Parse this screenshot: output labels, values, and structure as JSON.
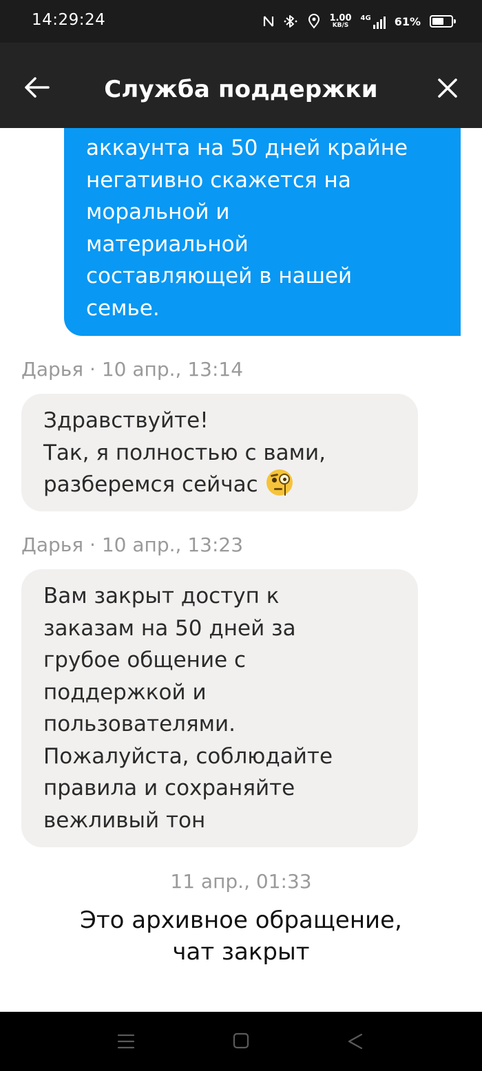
{
  "status_bar": {
    "time": "14:29:24",
    "speed_value": "1.00",
    "speed_unit": "KB/S",
    "network_type": "4G",
    "battery_percent": "61%",
    "battery_level": 0.61,
    "icons": [
      "nfc-icon",
      "bluetooth-icon",
      "location-icon",
      "signal-icon",
      "battery-icon"
    ]
  },
  "header": {
    "title": "Служба поддержки",
    "back_icon": "arrow-left-icon",
    "close_icon": "close-icon"
  },
  "messages": [
    {
      "from": "user",
      "lines": [
        "аккаунта на 50 дней крайне",
        "негативно скажется на",
        "моральной и",
        "материальной",
        "составляющей в нашей",
        "семье."
      ]
    },
    {
      "from": "support",
      "meta": "Дарья · 10 апр., 13:14",
      "lines": [
        "Здравствуйте!",
        "Так, я полностью с вами,",
        "разберемся сейчас"
      ],
      "emoji": "face-with-monocle-icon"
    },
    {
      "from": "support",
      "meta": "Дарья · 10 апр., 13:23",
      "lines": [
        "Вам закрыт доступ к",
        "заказам на 50 дней за",
        "грубое общение с",
        "поддержкой и",
        "пользователями.",
        "Пожалуйста, соблюдайте",
        "правила и сохраняйте",
        "вежливый тон"
      ]
    }
  ],
  "date_separator": "11 апр., 01:33",
  "archive_note": {
    "line1": "Это архивное обращение,",
    "line2": "чат закрыт"
  },
  "nav_bar": {
    "icons": [
      "menu-icon",
      "home-icon",
      "back-triangle-icon"
    ]
  },
  "colors": {
    "user_bubble": "#0998f3",
    "support_bubble": "#f1f0ef",
    "header_bg": "#242424",
    "status_bg": "#1c1c1c"
  }
}
